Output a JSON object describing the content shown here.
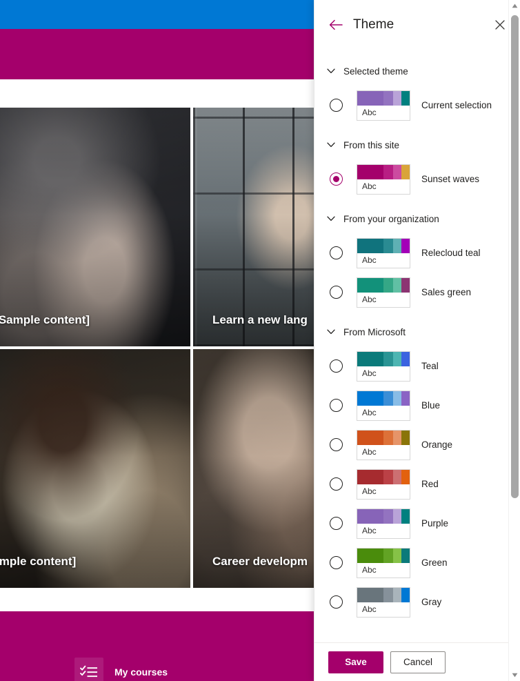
{
  "background": {
    "topbar_color": "#0078d4",
    "navbar_color": "#a4006b",
    "cards": [
      {
        "title": "s [Sample content]",
        "image": "handshake-photo"
      },
      {
        "title": "Learn a new lang",
        "image": "meeting-window-photo"
      },
      {
        "title": "Sample content]",
        "image": "woman-desk-photo"
      },
      {
        "title": "Career developm",
        "image": "hands-together-photo"
      }
    ],
    "footer": {
      "icon": "checklist-icon",
      "label": "My courses"
    }
  },
  "panel": {
    "title": "Theme",
    "back_icon": "back-arrow-icon",
    "close_icon": "close-icon",
    "accent_color": "#a4006b",
    "sections": [
      {
        "label": "Selected theme",
        "chevron": "chevron-down-icon",
        "options": [
          {
            "name": "Current selection",
            "selected": false,
            "swatch_text": "Abc",
            "colors": [
              "#8764b8",
              "#9373c0",
              "#b9a3d8",
              "#00807f"
            ]
          }
        ]
      },
      {
        "label": "From this site",
        "chevron": "chevron-down-icon",
        "options": [
          {
            "name": "Sunset waves",
            "selected": true,
            "swatch_text": "Abc",
            "colors": [
              "#a4006b",
              "#b81e83",
              "#cc4ba0",
              "#d9a43a"
            ]
          }
        ]
      },
      {
        "label": "From your organization",
        "chevron": "chevron-down-icon",
        "options": [
          {
            "name": "Relecloud teal",
            "selected": false,
            "swatch_text": "Abc",
            "colors": [
              "#10737d",
              "#2a8b92",
              "#5fb0b4",
              "#a300b8"
            ]
          },
          {
            "name": "Sales green",
            "selected": false,
            "swatch_text": "Abc",
            "colors": [
              "#12917a",
              "#35a786",
              "#61c0a4",
              "#8c3472"
            ]
          }
        ]
      },
      {
        "label": "From Microsoft",
        "chevron": "chevron-down-icon",
        "options": [
          {
            "name": "Teal",
            "selected": false,
            "swatch_text": "Abc",
            "colors": [
              "#0b7a7a",
              "#2a9494",
              "#4db5b2",
              "#3b63e0"
            ]
          },
          {
            "name": "Blue",
            "selected": false,
            "swatch_text": "Abc",
            "colors": [
              "#0078d4",
              "#3b8ed6",
              "#88bce6",
              "#8a63c4"
            ]
          },
          {
            "name": "Orange",
            "selected": false,
            "swatch_text": "Abc",
            "colors": [
              "#d0521b",
              "#dd7138",
              "#e69468",
              "#8a7408"
            ]
          },
          {
            "name": "Red",
            "selected": false,
            "swatch_text": "Abc",
            "colors": [
              "#a62b2f",
              "#bb4146",
              "#cc6f72",
              "#e2610f"
            ]
          },
          {
            "name": "Purple",
            "selected": false,
            "swatch_text": "Abc",
            "colors": [
              "#8764b8",
              "#9373c0",
              "#b9a3d8",
              "#00807f"
            ]
          },
          {
            "name": "Green",
            "selected": false,
            "swatch_text": "Abc",
            "colors": [
              "#4a8c0c",
              "#62a324",
              "#86c247",
              "#0b7a7a"
            ]
          },
          {
            "name": "Gray",
            "selected": false,
            "swatch_text": "Abc",
            "colors": [
              "#69757c",
              "#86919a",
              "#a9b4bb",
              "#0078d4"
            ]
          }
        ]
      }
    ],
    "footer": {
      "save_label": "Save",
      "cancel_label": "Cancel"
    }
  },
  "scrollbar": {
    "up_icon": "scroll-up-arrow-icon",
    "down_icon": "scroll-down-arrow-icon"
  }
}
